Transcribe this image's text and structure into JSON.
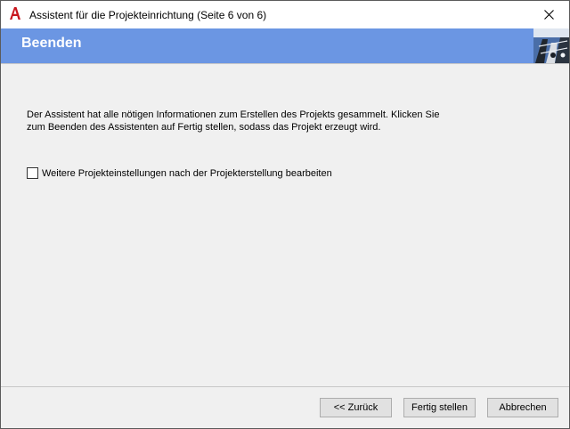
{
  "window": {
    "title": "Assistent für die Projekteinrichtung (Seite 6 von 6)",
    "app_icon": "autocad-a-icon",
    "close_icon": "close-icon"
  },
  "banner": {
    "title": "Beenden",
    "background_color": "#6b96e3"
  },
  "content": {
    "description_line1": "Der Assistent hat alle nötigen Informationen zum Erstellen des Projekts gesammelt. Klicken Sie",
    "description_line2": "zum Beenden des Assistenten auf Fertig stellen, sodass das Projekt erzeugt wird.",
    "checkbox": {
      "label": "Weitere Projekteinstellungen nach der Projekterstellung bearbeiten",
      "checked": false
    }
  },
  "footer": {
    "back_label": "<< Zurück",
    "finish_label": "Fertig stellen",
    "cancel_label": "Abbrechen"
  }
}
